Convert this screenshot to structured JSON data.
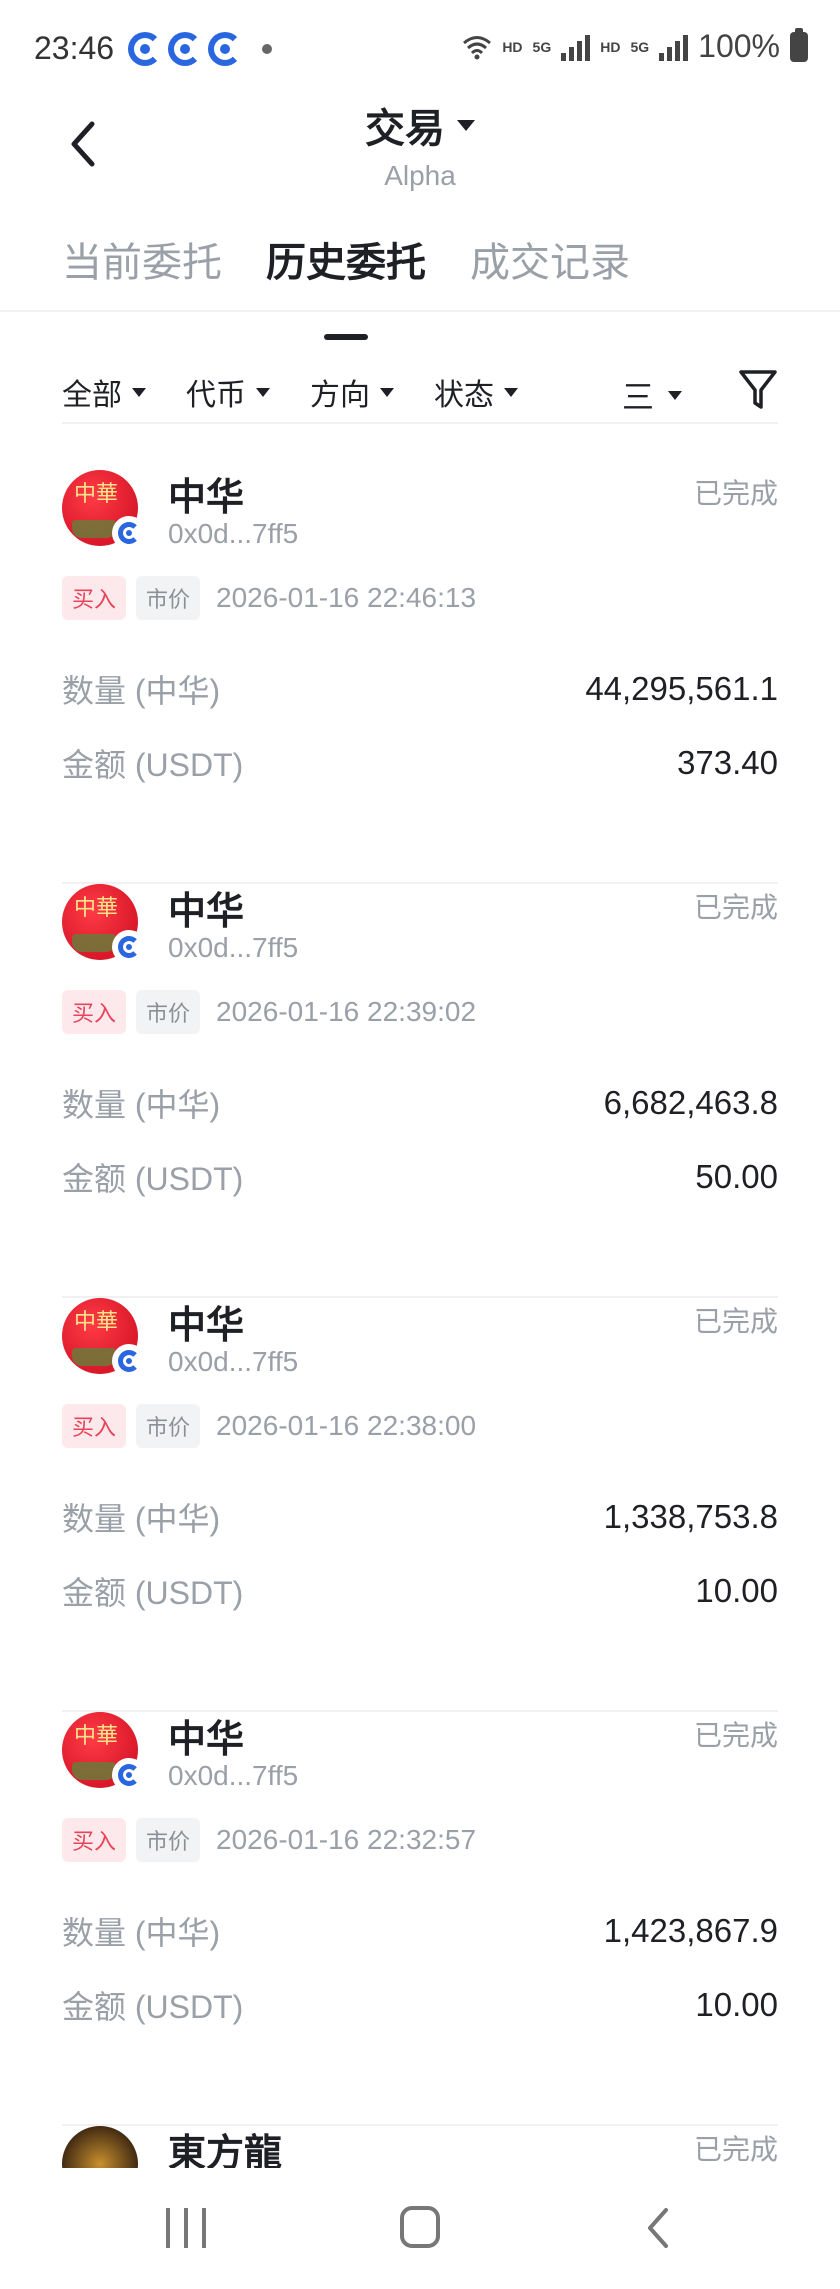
{
  "status_bar": {
    "time": "23:46",
    "wifi_label": "HD",
    "net1": "5G",
    "hd2": "HD",
    "net2": "5G",
    "battery": "100%"
  },
  "header": {
    "title": "交易",
    "subtitle": "Alpha"
  },
  "tabs": [
    {
      "label": "当前委托",
      "active": false
    },
    {
      "label": "历史委托",
      "active": true
    },
    {
      "label": "成交记录",
      "active": false
    }
  ],
  "filters": {
    "all": "全部",
    "token": "代币",
    "direction": "方向",
    "status": "状态",
    "sort_icon": "三"
  },
  "orders": [
    {
      "token": "中华",
      "address": "0x0d...7ff5",
      "status": "已完成",
      "side": "买入",
      "type": "市价",
      "time": "2026-01-16 22:46:13",
      "qty_label": "数量 (中华)",
      "qty": "44,295,561.1",
      "amount_label": "金额 (USDT)",
      "amount": "373.40"
    },
    {
      "token": "中华",
      "address": "0x0d...7ff5",
      "status": "已完成",
      "side": "买入",
      "type": "市价",
      "time": "2026-01-16 22:39:02",
      "qty_label": "数量 (中华)",
      "qty": "6,682,463.8",
      "amount_label": "金额 (USDT)",
      "amount": "50.00"
    },
    {
      "token": "中华",
      "address": "0x0d...7ff5",
      "status": "已完成",
      "side": "买入",
      "type": "市价",
      "time": "2026-01-16 22:38:00",
      "qty_label": "数量 (中华)",
      "qty": "1,338,753.8",
      "amount_label": "金额 (USDT)",
      "amount": "10.00"
    },
    {
      "token": "中华",
      "address": "0x0d...7ff5",
      "status": "已完成",
      "side": "买入",
      "type": "市价",
      "time": "2026-01-16 22:32:57",
      "qty_label": "数量 (中华)",
      "qty": "1,423,867.9",
      "amount_label": "金额 (USDT)",
      "amount": "10.00"
    },
    {
      "token": "東方龍",
      "status": "已完成"
    }
  ],
  "avatar_glyph": "中華",
  "colors": {
    "buy_tag_bg": "#fde9ec",
    "buy_tag_text": "#e8445a",
    "muted_text": "#9aa0a8",
    "primary_text": "#1e2026",
    "chain_badge": "#2a66e0"
  },
  "icons": [
    "back-arrow-icon",
    "caret-down-icon",
    "sort-lines-icon",
    "filter-funnel-icon",
    "chain-badge-icon",
    "nav-recent-icon",
    "nav-home-icon",
    "nav-back-icon"
  ]
}
